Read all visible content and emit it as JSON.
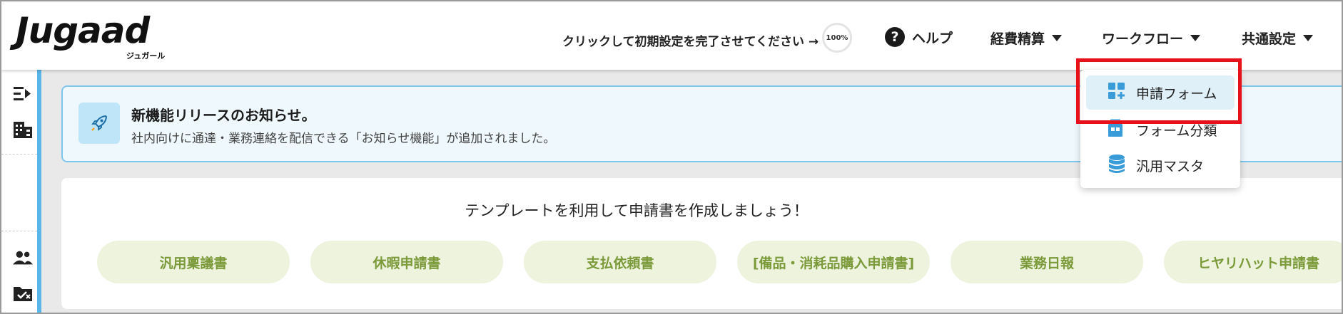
{
  "header": {
    "logo_main": "Jugaad",
    "logo_sub": "ジュガール",
    "setup_prompt": "クリックして初期設定を完了させてください →",
    "setup_progress": "100%",
    "help_label": "ヘルプ",
    "menus": [
      {
        "label": "経費精算"
      },
      {
        "label": "ワークフロー"
      },
      {
        "label": "共通設定"
      }
    ]
  },
  "dropdown": {
    "items": [
      {
        "label": "申請フォーム",
        "icon": "grid-plus-icon",
        "active": true
      },
      {
        "label": "フォーム分類",
        "icon": "form-category-icon",
        "active": false
      },
      {
        "label": "汎用マスタ",
        "icon": "database-icon",
        "active": false
      }
    ]
  },
  "notice": {
    "title": "新機能リリースのお知らせ。",
    "body": "社内向けに通達・業務連絡を配信できる「お知らせ機能」が追加されました。"
  },
  "templates": {
    "heading": "テンプレートを利用して申請書を作成しましょう！",
    "buttons": [
      {
        "label": "汎用稟議書"
      },
      {
        "label": "休暇申請書"
      },
      {
        "label": "支払依頼書"
      },
      {
        "label": "[備品・消耗品購入申請書]"
      },
      {
        "label": "業務日報"
      },
      {
        "label": "ヒヤリハット申請書"
      }
    ]
  },
  "sidebar": {
    "icons": [
      "expand-menu-icon",
      "building-icon",
      "users-icon",
      "folder-check-icon"
    ]
  },
  "colors": {
    "accent_blue": "#5ab6e8",
    "highlight_red": "#e8101a",
    "template_green": "#7b9a3a"
  }
}
